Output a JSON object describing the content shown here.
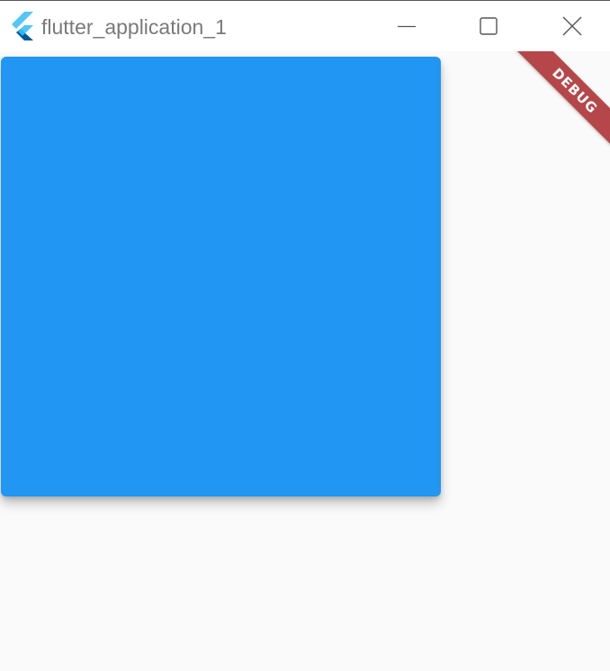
{
  "window": {
    "title": "flutter_application_1",
    "app_icon": "flutter-logo-icon",
    "controls": {
      "minimize_icon": "minimize-icon",
      "maximize_icon": "maximize-icon",
      "close_icon": "close-icon"
    }
  },
  "banner": {
    "label": "DEBUG",
    "color": "#b5474a"
  },
  "content": {
    "box_color": "#2196f3",
    "background": "#fafafa"
  }
}
